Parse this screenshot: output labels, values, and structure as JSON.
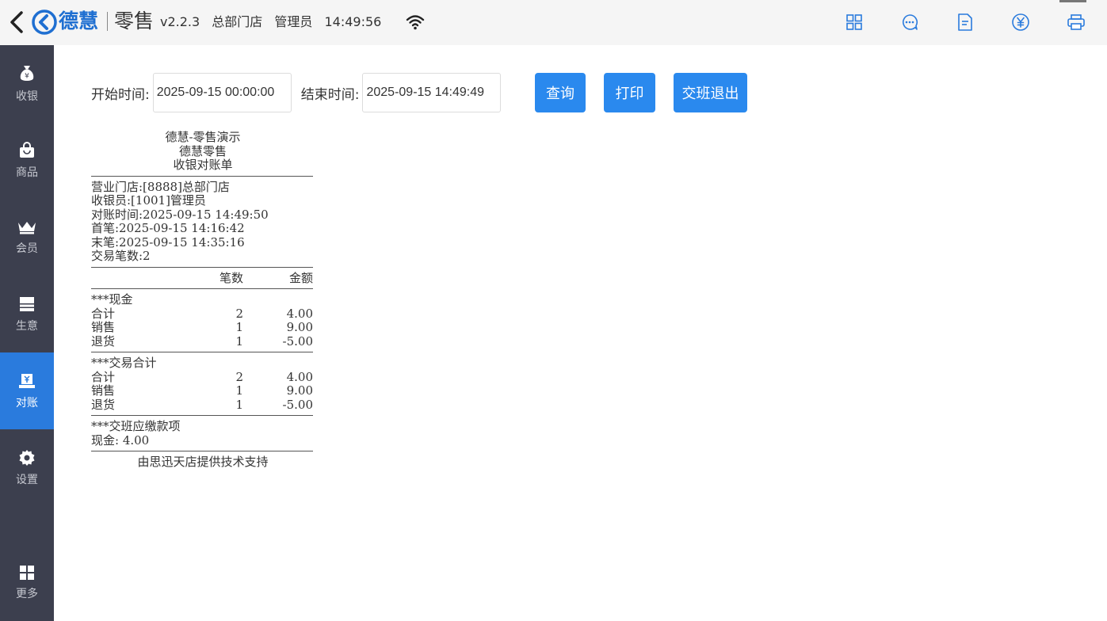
{
  "header": {
    "brand": "德慧",
    "app_name": "零售",
    "version": "v2.2.3",
    "store": "总部门店",
    "user": "管理员",
    "time": "14:49:56",
    "icons": [
      "grid-icon",
      "chat-bubble-icon",
      "document-icon",
      "yen-circle-icon",
      "printer-icon"
    ]
  },
  "sidebar": {
    "items": [
      {
        "label": "收银",
        "icon": "money-bag-icon"
      },
      {
        "label": "商品",
        "icon": "shopping-bag-icon"
      },
      {
        "label": "会员",
        "icon": "crown-icon"
      },
      {
        "label": "生意",
        "icon": "register-icon"
      },
      {
        "label": "对账",
        "icon": "reconcile-icon",
        "active": true
      },
      {
        "label": "设置",
        "icon": "gear-icon"
      },
      {
        "label": "更多",
        "icon": "apps-icon"
      }
    ]
  },
  "filter": {
    "start_label": "开始时间:",
    "start_value": "2025-09-15 00:00:00",
    "end_label": "结束时间:",
    "end_value": "2025-09-15 14:49:49",
    "query_btn": "查询",
    "print_btn": "打印",
    "handover_btn": "交班退出"
  },
  "receipt": {
    "title1": "德慧-零售演示",
    "title2": "德慧零售",
    "title3": "收银对账单",
    "store_line": "营业门店:[8888]总部门店",
    "cashier_line": "收银员:[1001]管理员",
    "recon_time_line": "对账时间:2025-09-15 14:49:50",
    "first_line": "首笔:2025-09-15 14:16:42",
    "last_line": "末笔:2025-09-15 14:35:16",
    "count_line": "交易笔数:2",
    "col_count": "笔数",
    "col_amount": "金额",
    "cash_section": "***现金",
    "cash_rows": [
      {
        "name": "合计",
        "count": "2",
        "amount": "4.00"
      },
      {
        "name": "销售",
        "count": "1",
        "amount": "9.00"
      },
      {
        "name": "退货",
        "count": "1",
        "amount": "-5.00"
      }
    ],
    "total_section": "***交易合计",
    "total_rows": [
      {
        "name": "合计",
        "count": "2",
        "amount": "4.00"
      },
      {
        "name": "销售",
        "count": "1",
        "amount": "9.00"
      },
      {
        "name": "退货",
        "count": "1",
        "amount": "-5.00"
      }
    ],
    "handover_section": "***交班应缴款项",
    "cash_due_line": "现金: 4.00",
    "footer": "由思迅天店提供技术支持"
  }
}
